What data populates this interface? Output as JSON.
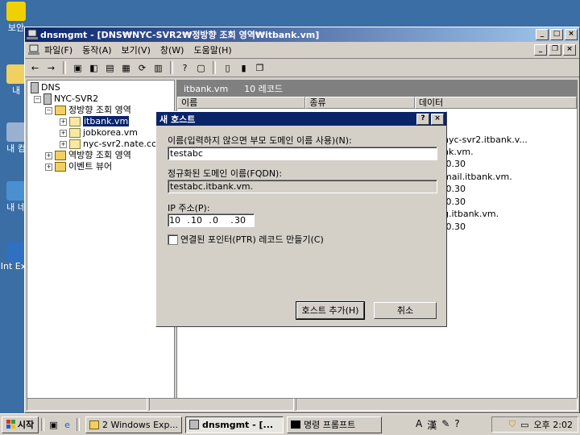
{
  "desktop": {
    "icons": [
      "보안",
      "내",
      "내 컴",
      "내 네",
      "Int Exp"
    ]
  },
  "window": {
    "title": "dnsmgmt - [DNS₩NYC-SVR2₩정방향 조회 영역₩itbank.vm]",
    "menu": [
      "파일(F)",
      "동작(A)",
      "보기(V)",
      "창(W)",
      "도움말(H)"
    ]
  },
  "tree": {
    "root": "DNS",
    "server": "NYC-SVR2",
    "forward_zone": "정방향 조회 영역",
    "zones": [
      "itbank.vm",
      "jobkorea.vm",
      "nyc-svr2.nate.co"
    ],
    "reverse_zone": "역방향 조회 영역",
    "event_viewer": "이벤트 뷰어"
  },
  "rightpane": {
    "zone_name": "itbank.vm",
    "record_count": "10 레코드",
    "columns": [
      "이름",
      "종류",
      "데이터"
    ],
    "visible_data": [
      "nyc-svr2.itbank.v...",
      "nk.vm.",
      ".0.30",
      "mail.itbank.vm.",
      ".0.30",
      ".0.30",
      "g.itbank.vm.",
      ".0.30"
    ]
  },
  "dialog": {
    "title": "새 호스트",
    "name_label": "이름(입력하지 않으면 부모 도메인 이름 사용)(N):",
    "name_value": "testabc",
    "fqdn_label": "정규화된 도메인 이름(FQDN):",
    "fqdn_value": "testabc.itbank.vm.",
    "ip_label": "IP 주소(P):",
    "ip_octets": [
      "10",
      "10",
      "0",
      "30"
    ],
    "ptr_label": "연결된 포인터(PTR) 레코드 만들기(C)",
    "add_button": "호스트 추가(H)",
    "cancel_button": "취소"
  },
  "taskbar": {
    "start": "시작",
    "tasks": [
      "2 Windows Exp...",
      "dnsmgmt - [...",
      "명령 프롬프트"
    ],
    "ime": [
      "A",
      "漢"
    ],
    "clock": "오후 2:02"
  }
}
